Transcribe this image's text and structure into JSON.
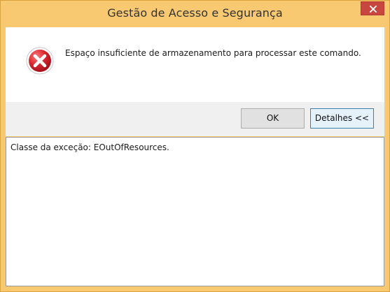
{
  "window": {
    "title": "Gestão de Acesso e Segurança"
  },
  "dialog": {
    "icon": "error-icon",
    "message": "Espaço insuficiente de armazenamento para processar este comando."
  },
  "buttons": {
    "ok_label": "OK",
    "details_label": "Detalhes <<"
  },
  "details": {
    "text": "Classe da exceção: EOutOfResources."
  },
  "colors": {
    "frame": "#f8c971",
    "close_button": "#c7463f",
    "error_red": "#d9272e",
    "footer": "#f0f0f0"
  }
}
